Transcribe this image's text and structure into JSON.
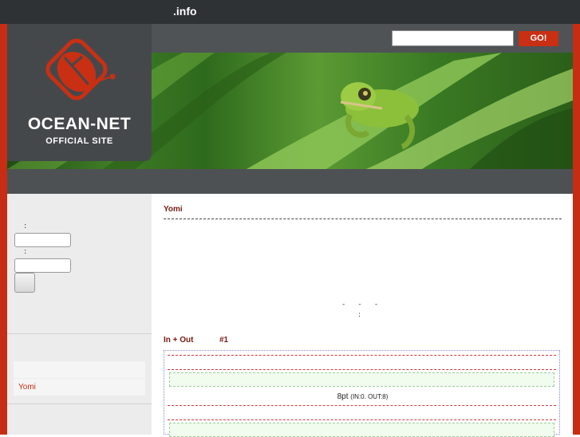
{
  "header": {
    "site_title": ".info"
  },
  "logo": {
    "name": "OCEAN-NET",
    "tagline": "OFFICIAL SITE"
  },
  "search": {
    "value": "",
    "go_label": "GO!"
  },
  "sidebar": {
    "field1_label": ":",
    "field2_label": ":",
    "menu_items": [
      "",
      "Yomi"
    ]
  },
  "main": {
    "section1_title": "Yomi",
    "dash_text": "-      -      -",
    "colon_text": ":",
    "section2_title": "In + Out",
    "section2_number": "#1",
    "stats": {
      "size": "8pt",
      "detail": "(IN:0. OUT:8)"
    }
  },
  "colors": {
    "accent": "#c62d13",
    "topbar": "#2e3235",
    "panel": "#45484b"
  }
}
